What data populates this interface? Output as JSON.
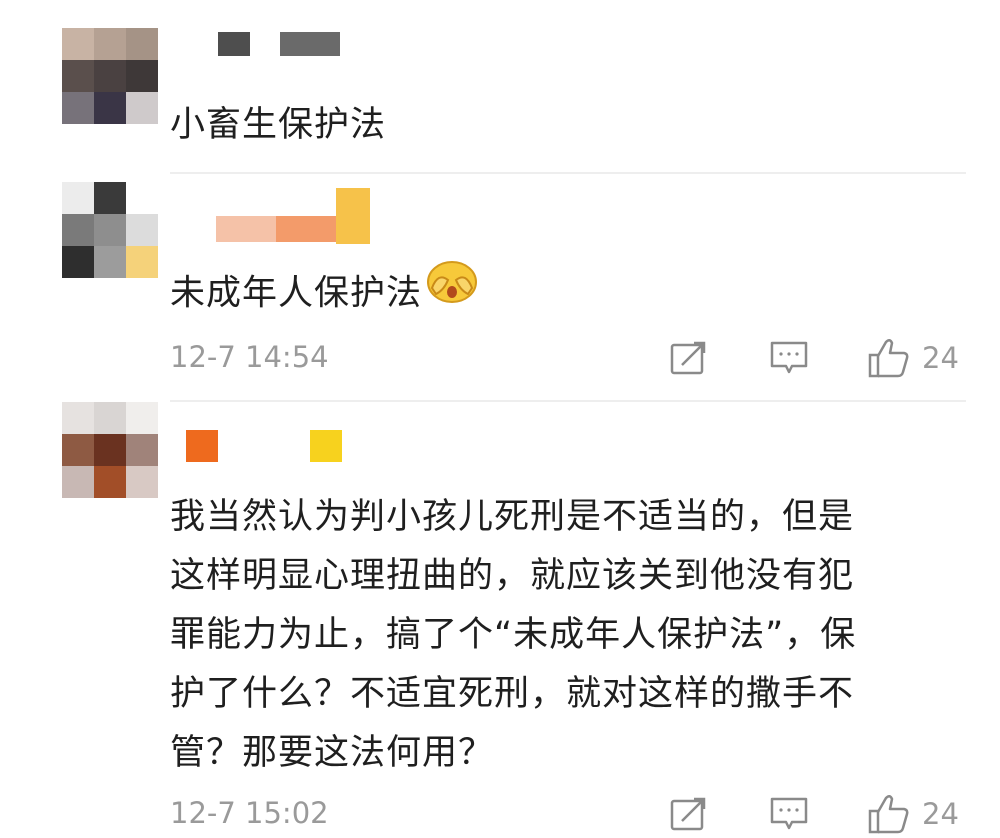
{
  "comments": [
    {
      "text": "小畜生保护法",
      "avatar_colors": [
        "#c8b3a4",
        "#b5a193",
        "#a59386",
        "#5a4f4c",
        "#4a4141",
        "#3e3838",
        "#77727a",
        "#3a3546",
        "#cfcacb"
      ],
      "name_colors": [
        "#4e4e4e",
        "#6a6a6a"
      ]
    },
    {
      "text": "未成年人保护法",
      "emoji": "covering-face-emoji",
      "time": "12-7 14:54",
      "likes": "24",
      "avatar_colors": [
        "#ececec",
        "#3a3a3a",
        "#ffffff",
        "#7a7a7a",
        "#8e8e8e",
        "#dcdcdc",
        "#2e2e2e",
        "#9c9c9c",
        "#f5d27a"
      ],
      "name_colors": [
        "#f5c2a8",
        "#f39b6a",
        "#f6c24a"
      ]
    },
    {
      "text": "我当然认为判小孩儿死刑是不适当的，但是\n这样明显心理扭曲的，就应该关到他没有犯\n罪能力为止，搞了个“未成年人保护法”，保\n护了什么？不适宜死刑，就对这样的撒手不\n管？那要这法何用？",
      "lines": [
        "我当然认为判小孩儿死刑是不适当的，但是",
        "这样明显心理扭曲的，就应该关到他没有犯",
        "罪能力为止，搞了个“未成年人保护法”，保",
        "护了什么？不适宜死刑，就对这样的撒手不",
        "管？那要这法何用？"
      ],
      "time": "12-7 15:02",
      "likes": "24",
      "avatar_colors": [
        "#e6e2e0",
        "#d9d5d3",
        "#f0eeec",
        "#8e5a43",
        "#6a3220",
        "#a0837a",
        "#c8b8b4",
        "#a24e28",
        "#d8c9c4"
      ],
      "name_colors": [
        "#ee6a1e",
        "#f7d21e"
      ]
    }
  ],
  "icons": {
    "share": "share-icon",
    "comment": "comment-icon",
    "like": "thumbs-up-icon"
  }
}
